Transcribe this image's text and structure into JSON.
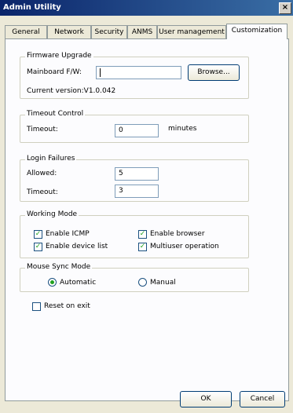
{
  "window": {
    "title": "Admin Utility",
    "close_label": "×"
  },
  "tabs": [
    {
      "label": "General"
    },
    {
      "label": "Network"
    },
    {
      "label": "Security"
    },
    {
      "label": "ANMS"
    },
    {
      "label": "User management"
    },
    {
      "label": "Customization",
      "active": true
    }
  ],
  "firmware": {
    "title": "Firmware Upgrade",
    "mainboard_label": "Mainboard F/W:",
    "mainboard_value": "",
    "browse_label": "Browse...",
    "current_version": "Current version:V1.0.042"
  },
  "timeout_control": {
    "title": "Timeout Control",
    "timeout_label": "Timeout:",
    "timeout_value": "0",
    "unit": "minutes"
  },
  "login_failures": {
    "title": "Login Failures",
    "allowed_label": "Allowed:",
    "allowed_value": "5",
    "timeout_label": "Timeout:",
    "timeout_value": "3"
  },
  "working_mode": {
    "title": "Working Mode",
    "enable_icmp": {
      "label": "Enable ICMP",
      "checked": true
    },
    "enable_browser": {
      "label": "Enable browser",
      "checked": true
    },
    "enable_device_list": {
      "label": "Enable device list",
      "checked": true
    },
    "multiuser": {
      "label": "Multiuser operation",
      "checked": true
    }
  },
  "mouse_sync": {
    "title": "Mouse Sync Mode",
    "automatic": {
      "label": "Automatic",
      "selected": true
    },
    "manual": {
      "label": "Manual",
      "selected": false
    }
  },
  "reset_on_exit": {
    "label": "Reset on exit",
    "checked": false
  },
  "buttons": {
    "ok": "OK",
    "cancel": "Cancel"
  },
  "check_glyph": "✓"
}
